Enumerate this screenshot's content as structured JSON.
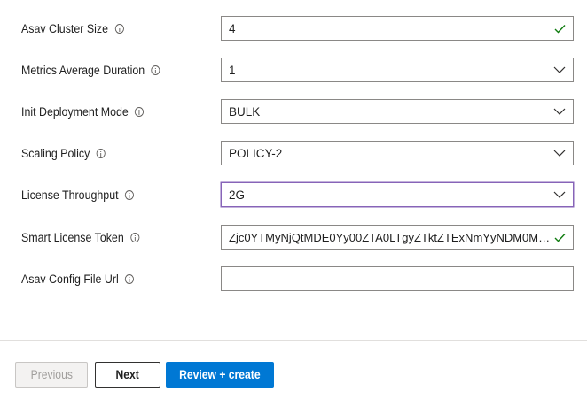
{
  "form": {
    "fields": [
      {
        "label": "Asav Cluster Size",
        "value": "4",
        "control": "text",
        "status": "valid"
      },
      {
        "label": "Metrics Average Duration",
        "value": "1",
        "control": "dropdown"
      },
      {
        "label": "Init Deployment Mode",
        "value": "BULK",
        "control": "dropdown"
      },
      {
        "label": "Scaling Policy",
        "value": "POLICY-2",
        "control": "dropdown"
      },
      {
        "label": "License Throughput",
        "value": "2G",
        "control": "dropdown",
        "state": "focused"
      },
      {
        "label": "Smart License Token",
        "value": "Zjc0YTMyNjQtMDE0Yy00ZTA0LTgyZTktZTExNmYyNDM0MWFkLTE3Mj...",
        "control": "text",
        "status": "valid"
      },
      {
        "label": "Asav Config File Url",
        "value": "",
        "control": "text"
      }
    ]
  },
  "footer": {
    "previous_label": "Previous",
    "next_label": "Next",
    "review_label": "Review + create"
  },
  "icons": {
    "info": "info-icon",
    "dropdown": "chevron-down-icon",
    "valid": "checkmark-icon"
  },
  "colors": {
    "primary": "#0078d4",
    "valid_check": "#107c10",
    "focus_border": "#8764b8",
    "input_border": "#8a8886",
    "disabled_text": "#a19f9d"
  }
}
